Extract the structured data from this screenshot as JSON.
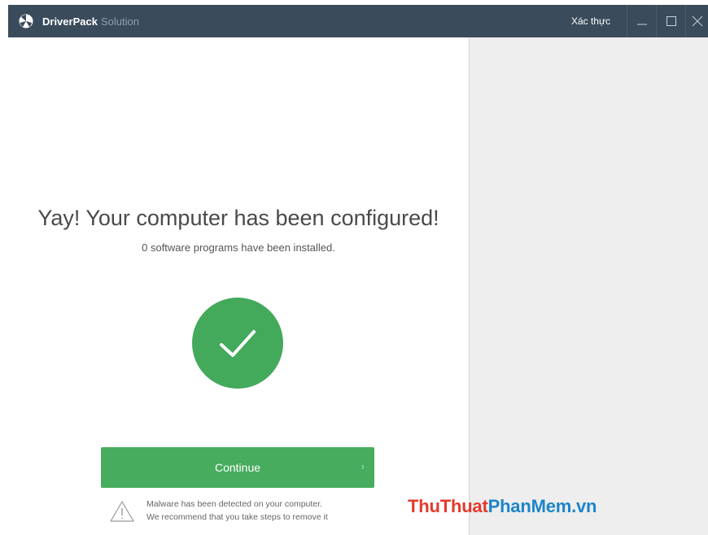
{
  "window": {
    "app_name": "DriverPack",
    "app_sub": "Solution",
    "auth_link": "Xác thực",
    "icons": {
      "logo": "driverpack-logo-icon",
      "minimize": "minimize-icon",
      "maximize": "maximize-icon",
      "close": "close-icon"
    }
  },
  "main": {
    "headline": "Yay! Your computer has been configured!",
    "subline": "0 software programs have been installed.",
    "status_icon": "checkmark-icon",
    "continue_label": "Continue",
    "continue_arrow": "›",
    "warning": {
      "icon": "warning-triangle-icon",
      "line1": "Malware has been detected on your computer.",
      "line2": "We recommend that you take steps to remove it"
    }
  },
  "watermark": {
    "part1": "ThuThuat",
    "part2": "PhanMem.vn"
  },
  "colors": {
    "titlebar": "#3a4b5c",
    "accent_green": "#48ac5e",
    "side_panel": "#eeeeee",
    "watermark_red": "#e33a2b",
    "watermark_blue": "#1c85c9"
  }
}
